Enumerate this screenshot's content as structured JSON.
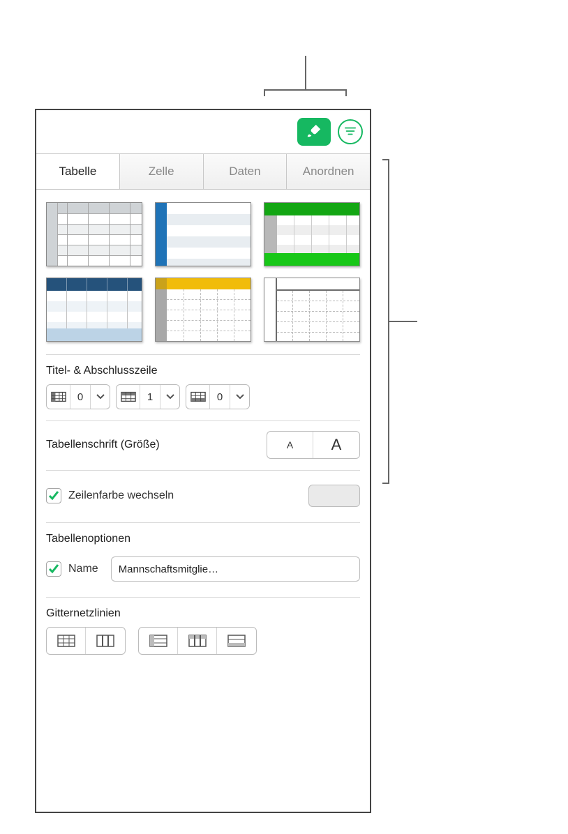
{
  "toolbar": {
    "format_icon": "paintbrush-icon",
    "organize_icon": "organize-icon"
  },
  "tabs": [
    {
      "label": "Tabelle",
      "active": true
    },
    {
      "label": "Zelle",
      "active": false
    },
    {
      "label": "Daten",
      "active": false
    },
    {
      "label": "Anordnen",
      "active": false
    }
  ],
  "headers_footers": {
    "title": "Titel- & Abschlusszeile",
    "header_cols": 0,
    "header_rows": 1,
    "footer_rows": 0
  },
  "table_font": {
    "title": "Tabellenschrift (Größe)",
    "smaller": "A",
    "larger": "A"
  },
  "alternating": {
    "label": "Zeilenfarbe wechseln",
    "checked": true,
    "swatch": "#eaeaea"
  },
  "table_options": {
    "title": "Tabellenoptionen",
    "name_checked": true,
    "name_label": "Name",
    "name_value": "Mannschaftsmitglie…"
  },
  "gridlines": {
    "title": "Gitternetzlinien"
  }
}
